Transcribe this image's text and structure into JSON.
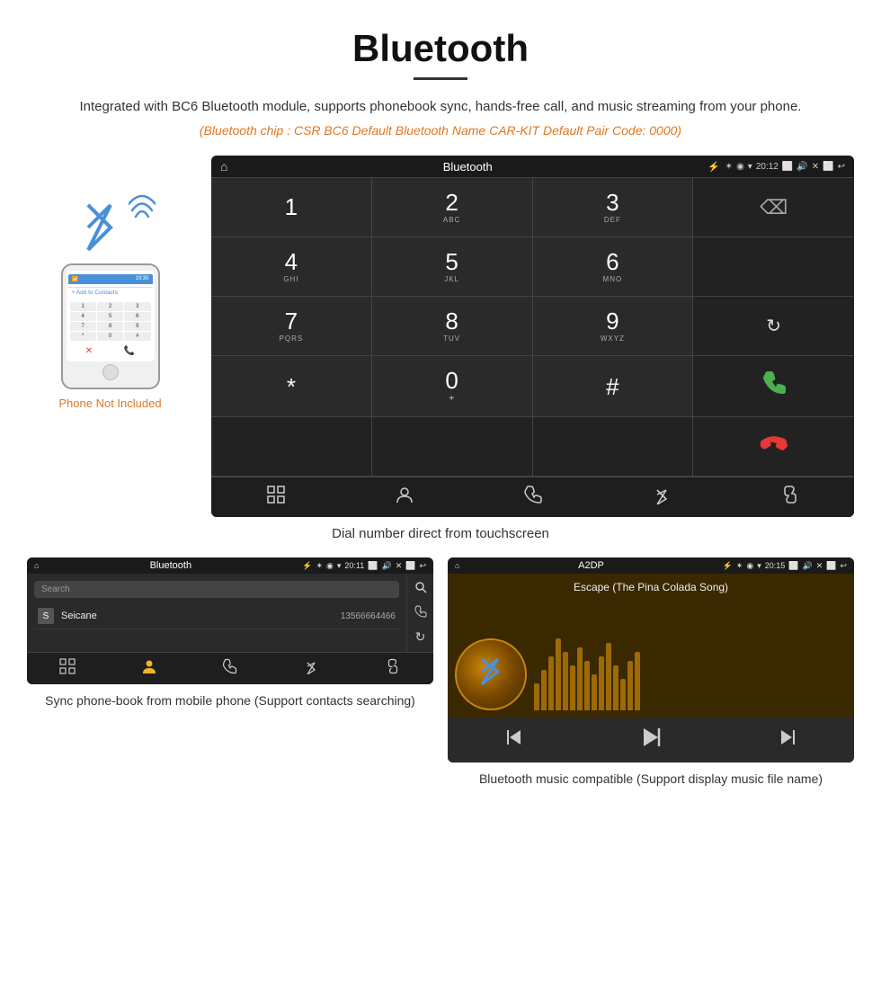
{
  "page": {
    "title": "Bluetooth",
    "subtitle": "Integrated with BC6 Bluetooth module, supports phonebook sync, hands-free call, and music streaming from your phone.",
    "bt_info": "(Bluetooth chip : CSR BC6    Default Bluetooth Name CAR-KIT    Default Pair Code: 0000)",
    "dial_caption": "Dial number direct from touchscreen",
    "phone_not_included": "Phone Not Included",
    "phonebook_caption": "Sync phone-book from mobile phone\n(Support contacts searching)",
    "music_caption": "Bluetooth music compatible\n(Support display music file name)"
  },
  "status_bar": {
    "title": "Bluetooth",
    "title_a2dp": "A2DP",
    "time": "20:12",
    "time2": "20:11",
    "time3": "20:15"
  },
  "keypad": {
    "keys": [
      {
        "num": "1",
        "sub": ""
      },
      {
        "num": "2",
        "sub": "ABC"
      },
      {
        "num": "3",
        "sub": "DEF"
      },
      {
        "num": "",
        "sub": ""
      },
      {
        "num": "4",
        "sub": "GHI"
      },
      {
        "num": "5",
        "sub": "JKL"
      },
      {
        "num": "6",
        "sub": "MNO"
      },
      {
        "num": "",
        "sub": ""
      },
      {
        "num": "7",
        "sub": "PQRS"
      },
      {
        "num": "8",
        "sub": "TUV"
      },
      {
        "num": "9",
        "sub": "WXYZ"
      },
      {
        "num": "",
        "sub": ""
      },
      {
        "num": "*",
        "sub": ""
      },
      {
        "num": "0",
        "sub": "+"
      },
      {
        "num": "#",
        "sub": ""
      }
    ],
    "backspace": "⌫",
    "call_green": "📞",
    "call_red": "📞",
    "refresh": "↻"
  },
  "phonebook": {
    "search_placeholder": "Search",
    "contact": {
      "initial": "S",
      "name": "Seicane",
      "number": "13566664466"
    }
  },
  "music": {
    "song_title": "Escape (The Pina Colada Song)",
    "eq_bars": [
      30,
      45,
      60,
      80,
      65,
      50,
      70,
      55,
      40,
      60,
      75,
      50,
      35,
      55,
      65
    ]
  },
  "nav_icons": {
    "grid": "⊞",
    "person": "👤",
    "phone": "📞",
    "bluetooth": "⚡",
    "link": "🔗"
  }
}
